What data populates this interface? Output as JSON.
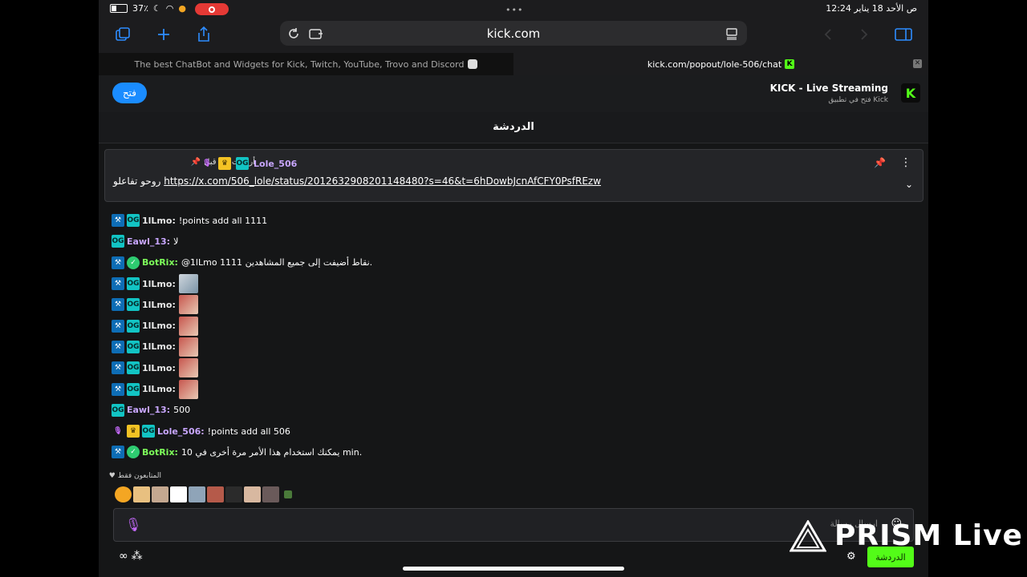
{
  "status_bar": {
    "battery": "37٪",
    "time": "12:24 ص  الأحد 18 يناير"
  },
  "browser": {
    "url": "kick.com"
  },
  "tabs": [
    {
      "label": "The best ChatBot and Widgets for Kick, Twitch, YouTube, Trovo and Discord"
    },
    {
      "label": "kick.com/popout/lole-506/chat"
    }
  ],
  "app_banner": {
    "open_label": "فتح",
    "title": "KICK - Live Streaming",
    "subtitle": "فتح في تطبيق Kick"
  },
  "chat": {
    "title": "الدردشة"
  },
  "pinned": {
    "sent_before": "أرسلت من قبل",
    "username": "Lole_506",
    "text_prefix": "روحو تفاعلو",
    "link": "https://x.com/506_lole/status/2012632908201148480?s=46&t=6hDowbJcnAfCFY0PsfREzw"
  },
  "messages": [
    {
      "user": "1lLmo:",
      "color": "#e8e8e8",
      "badges": [
        "mod",
        "og"
      ],
      "text": "!points add all 1111"
    },
    {
      "user": "Eawl_13:",
      "color": "#c9a7ff",
      "badges": [
        "og"
      ],
      "text": "لا"
    },
    {
      "user": "BotRix:",
      "color": "#7dff5a",
      "badges": [
        "mod",
        "verified"
      ],
      "text": "@1lLmo 1111 نقاط أضيفت إلى جميع المشاهدين."
    },
    {
      "user": "1lLmo:",
      "color": "#e8e8e8",
      "badges": [
        "mod",
        "og"
      ],
      "emote": true,
      "emote_variant": "e2"
    },
    {
      "user": "1lLmo:",
      "color": "#e8e8e8",
      "badges": [
        "mod",
        "og"
      ],
      "emote": true
    },
    {
      "user": "1lLmo:",
      "color": "#e8e8e8",
      "badges": [
        "mod",
        "og"
      ],
      "emote": true
    },
    {
      "user": "1lLmo:",
      "color": "#e8e8e8",
      "badges": [
        "mod",
        "og"
      ],
      "emote": true
    },
    {
      "user": "1lLmo:",
      "color": "#e8e8e8",
      "badges": [
        "mod",
        "og"
      ],
      "emote": true
    },
    {
      "user": "1lLmo:",
      "color": "#e8e8e8",
      "badges": [
        "mod",
        "og"
      ],
      "emote": true
    },
    {
      "user": "Eawl_13:",
      "color": "#c9a7ff",
      "badges": [
        "og"
      ],
      "text": "500"
    },
    {
      "user": "Lole_506:",
      "color": "#c9a7ff",
      "badges": [
        "mic",
        "crown",
        "og"
      ],
      "text": "!points add all 506"
    },
    {
      "user": "BotRix:",
      "color": "#7dff5a",
      "badges": [
        "mod",
        "verified"
      ],
      "text": "يمكنك استخدام هذا الأمر مرة أخرى في 10 min."
    }
  ],
  "followers_only_label": "المتابعون فقط",
  "input": {
    "placeholder": "ارسال رسالة"
  },
  "send_label": "الدردشة",
  "overlay": {
    "brand": "PRISM Live"
  },
  "colors": {
    "kick_green": "#53fc18",
    "open_blue": "#1a8cff",
    "record_red": "#e53935"
  }
}
